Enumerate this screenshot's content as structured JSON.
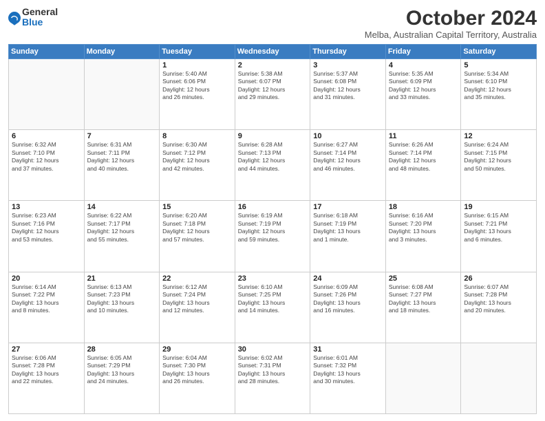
{
  "logo": {
    "general": "General",
    "blue": "Blue"
  },
  "header": {
    "month": "October 2024",
    "location": "Melba, Australian Capital Territory, Australia"
  },
  "days_of_week": [
    "Sunday",
    "Monday",
    "Tuesday",
    "Wednesday",
    "Thursday",
    "Friday",
    "Saturday"
  ],
  "weeks": [
    [
      {
        "day": "",
        "info": ""
      },
      {
        "day": "",
        "info": ""
      },
      {
        "day": "1",
        "info": "Sunrise: 5:40 AM\nSunset: 6:06 PM\nDaylight: 12 hours\nand 26 minutes."
      },
      {
        "day": "2",
        "info": "Sunrise: 5:38 AM\nSunset: 6:07 PM\nDaylight: 12 hours\nand 29 minutes."
      },
      {
        "day": "3",
        "info": "Sunrise: 5:37 AM\nSunset: 6:08 PM\nDaylight: 12 hours\nand 31 minutes."
      },
      {
        "day": "4",
        "info": "Sunrise: 5:35 AM\nSunset: 6:09 PM\nDaylight: 12 hours\nand 33 minutes."
      },
      {
        "day": "5",
        "info": "Sunrise: 5:34 AM\nSunset: 6:10 PM\nDaylight: 12 hours\nand 35 minutes."
      }
    ],
    [
      {
        "day": "6",
        "info": "Sunrise: 6:32 AM\nSunset: 7:10 PM\nDaylight: 12 hours\nand 37 minutes."
      },
      {
        "day": "7",
        "info": "Sunrise: 6:31 AM\nSunset: 7:11 PM\nDaylight: 12 hours\nand 40 minutes."
      },
      {
        "day": "8",
        "info": "Sunrise: 6:30 AM\nSunset: 7:12 PM\nDaylight: 12 hours\nand 42 minutes."
      },
      {
        "day": "9",
        "info": "Sunrise: 6:28 AM\nSunset: 7:13 PM\nDaylight: 12 hours\nand 44 minutes."
      },
      {
        "day": "10",
        "info": "Sunrise: 6:27 AM\nSunset: 7:14 PM\nDaylight: 12 hours\nand 46 minutes."
      },
      {
        "day": "11",
        "info": "Sunrise: 6:26 AM\nSunset: 7:14 PM\nDaylight: 12 hours\nand 48 minutes."
      },
      {
        "day": "12",
        "info": "Sunrise: 6:24 AM\nSunset: 7:15 PM\nDaylight: 12 hours\nand 50 minutes."
      }
    ],
    [
      {
        "day": "13",
        "info": "Sunrise: 6:23 AM\nSunset: 7:16 PM\nDaylight: 12 hours\nand 53 minutes."
      },
      {
        "day": "14",
        "info": "Sunrise: 6:22 AM\nSunset: 7:17 PM\nDaylight: 12 hours\nand 55 minutes."
      },
      {
        "day": "15",
        "info": "Sunrise: 6:20 AM\nSunset: 7:18 PM\nDaylight: 12 hours\nand 57 minutes."
      },
      {
        "day": "16",
        "info": "Sunrise: 6:19 AM\nSunset: 7:19 PM\nDaylight: 12 hours\nand 59 minutes."
      },
      {
        "day": "17",
        "info": "Sunrise: 6:18 AM\nSunset: 7:19 PM\nDaylight: 13 hours\nand 1 minute."
      },
      {
        "day": "18",
        "info": "Sunrise: 6:16 AM\nSunset: 7:20 PM\nDaylight: 13 hours\nand 3 minutes."
      },
      {
        "day": "19",
        "info": "Sunrise: 6:15 AM\nSunset: 7:21 PM\nDaylight: 13 hours\nand 6 minutes."
      }
    ],
    [
      {
        "day": "20",
        "info": "Sunrise: 6:14 AM\nSunset: 7:22 PM\nDaylight: 13 hours\nand 8 minutes."
      },
      {
        "day": "21",
        "info": "Sunrise: 6:13 AM\nSunset: 7:23 PM\nDaylight: 13 hours\nand 10 minutes."
      },
      {
        "day": "22",
        "info": "Sunrise: 6:12 AM\nSunset: 7:24 PM\nDaylight: 13 hours\nand 12 minutes."
      },
      {
        "day": "23",
        "info": "Sunrise: 6:10 AM\nSunset: 7:25 PM\nDaylight: 13 hours\nand 14 minutes."
      },
      {
        "day": "24",
        "info": "Sunrise: 6:09 AM\nSunset: 7:26 PM\nDaylight: 13 hours\nand 16 minutes."
      },
      {
        "day": "25",
        "info": "Sunrise: 6:08 AM\nSunset: 7:27 PM\nDaylight: 13 hours\nand 18 minutes."
      },
      {
        "day": "26",
        "info": "Sunrise: 6:07 AM\nSunset: 7:28 PM\nDaylight: 13 hours\nand 20 minutes."
      }
    ],
    [
      {
        "day": "27",
        "info": "Sunrise: 6:06 AM\nSunset: 7:28 PM\nDaylight: 13 hours\nand 22 minutes."
      },
      {
        "day": "28",
        "info": "Sunrise: 6:05 AM\nSunset: 7:29 PM\nDaylight: 13 hours\nand 24 minutes."
      },
      {
        "day": "29",
        "info": "Sunrise: 6:04 AM\nSunset: 7:30 PM\nDaylight: 13 hours\nand 26 minutes."
      },
      {
        "day": "30",
        "info": "Sunrise: 6:02 AM\nSunset: 7:31 PM\nDaylight: 13 hours\nand 28 minutes."
      },
      {
        "day": "31",
        "info": "Sunrise: 6:01 AM\nSunset: 7:32 PM\nDaylight: 13 hours\nand 30 minutes."
      },
      {
        "day": "",
        "info": ""
      },
      {
        "day": "",
        "info": ""
      }
    ]
  ]
}
